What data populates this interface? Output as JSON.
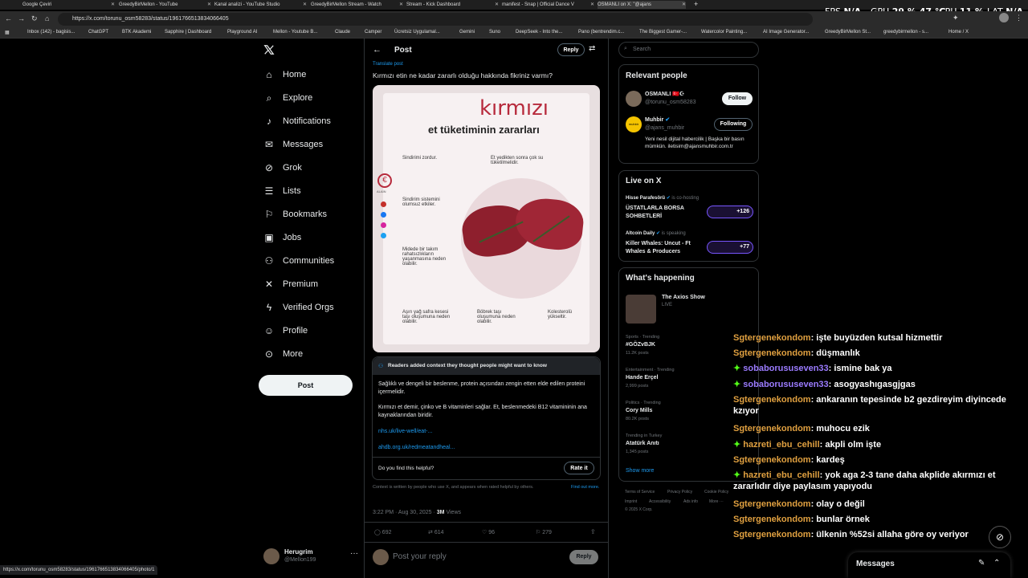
{
  "browser": {
    "tabs": [
      "Google Çeviri",
      "GreedyBirMellon - YouTube",
      "Kanal analizi - YouTube Studio",
      "GreedyBirMellon Stream - Watch",
      "Stream - Kick Dashboard",
      "manifest - Snap | Official Dance V",
      "OSMANLI on X: \"@ajans"
    ],
    "url": "https://x.com/torunu_osm58283/status/1961766513834066405",
    "bookmarks": [
      "Inbox (142) - bagisis...",
      "ChatGPT",
      "BTK Akademi",
      "Sapphire | Dashboard",
      "Playground AI",
      "Mellon - Youtube B...",
      "Claude",
      "Camper",
      "Ücretsiz Uygulamal...",
      "Gemini",
      "Suno",
      "DeepSeek - Into the...",
      "Pano (bentrendim.c...",
      "The Biggest Gamer-...",
      "Watercolor Painting...",
      "AI Image Generator...",
      "GreedyBirMellon St...",
      "greedybirmellon - s...",
      "Home / X"
    ],
    "status_url": "https://x.com/torunu_osm58283/status/1961766513834066405/photo/1"
  },
  "hud": {
    "fps_label": "FPS",
    "fps": "N/A",
    "gpu_label": "GPU",
    "gpu": "29 %  47 °C",
    "cpu_label": "CPU",
    "cpu": "11 %",
    "lat_label": "LAT",
    "lat": "N/A"
  },
  "nav": {
    "items": [
      "Home",
      "Explore",
      "Notifications",
      "Messages",
      "Grok",
      "Lists",
      "Bookmarks",
      "Jobs",
      "Communities",
      "Premium",
      "Verified Orgs",
      "Profile",
      "More"
    ],
    "post_button": "Post"
  },
  "account": {
    "name": "Herugrim",
    "handle": "@Mellon199"
  },
  "post": {
    "header": "Post",
    "reply_button": "Reply",
    "translate": "Translate post",
    "text": "Kırmızı etin ne kadar zararlı olduğu hakkında fikriniz varmı?",
    "image": {
      "title1": "kırmızı",
      "title2": "et tüketiminin zararları",
      "brand": "ALAİN",
      "facts": [
        "Sindirimi zordur.",
        "Et yedikten sonra çok su tüketilmelidir.",
        "Sindirim sistemini olumsuz etkiler.",
        "Midede bir takım rahatsızlıkların yaşanmasına neden olabilir.",
        "Aşırı yağ safra kesesi taşı oluşumuna neden olabilir.",
        "Böbrek taşı oluşumuna neden olabilir.",
        "Kolesterolü yükseltir."
      ]
    },
    "context": {
      "header": "Readers added context they thought people might want to know",
      "p1": "Sağlıklı ve dengeli bir beslenme, protein açısından zengin etten elde edilen proteini içermelidir.",
      "p2": "Kırmızı et demir, çinko ve B vitaminleri sağlar. Et, beslenmedeki B12 vitamininin ana kaynaklarından biridir.",
      "link1": "nhs.uk/live-well/eat-...",
      "link2": "ahdb.org.uk/redmeatandheal...",
      "helpful": "Do you find this helpful?",
      "rate": "Rate it",
      "footer": "Context is written by people who use X, and appears when rated helpful by others.",
      "find_out": "Find out more."
    },
    "meta": "3:22 PM · Aug 30, 2025 · ",
    "views": "3M",
    "views_label": " Views",
    "stats": {
      "replies": "692",
      "reposts": "614",
      "likes": "96",
      "bookmarks": "279"
    },
    "reply_placeholder": "Post your reply",
    "reply_btn": "Reply"
  },
  "right": {
    "search_placeholder": "Search",
    "relevant": {
      "title": "Relevant people",
      "p1": {
        "name": "OSMANLI 🇹🇷☪",
        "handle": "@torunu_osm58283",
        "btn": "Follow"
      },
      "p2": {
        "name": "Muhbir",
        "handle": "@ajans_muhbir",
        "btn": "Following",
        "bio": "Yeni nesil dijital habercilik | Başka bir basın mümkün. iletisim@ajansmuhbir.com.tr",
        "avatar_text": "muhbir"
      }
    },
    "live": {
      "title": "Live on X",
      "s1": {
        "host": "Hisse Parafesörü",
        "status": "is co-hosting",
        "title": "ÜSTATLARLA BORSA SOHBETLERİ",
        "count": "+126"
      },
      "s2": {
        "host": "Altcoin Daily",
        "status": "is speaking",
        "title": "Killer Whales: Uncut - Ft Whales & Producers",
        "count": "+77"
      }
    },
    "happening": {
      "title": "What's happening",
      "show": {
        "name": "The Axios Show",
        "status": "LIVE"
      },
      "trends": [
        {
          "cat": "Sports · Trending",
          "name": "#GÖZvBJK",
          "posts": "11.2K posts"
        },
        {
          "cat": "Entertainment · Trending",
          "name": "Hande Erçel",
          "posts": "2,999 posts"
        },
        {
          "cat": "Politics · Trending",
          "name": "Cory Mills",
          "posts": "80.2K posts"
        },
        {
          "cat": "Trending in Turkey",
          "name": "Atatürk Anıtı",
          "posts": "1,345 posts"
        }
      ],
      "show_more": "Show more"
    },
    "footer": [
      "Terms of Service",
      "Privacy Policy",
      "Cookie Policy",
      "Imprint",
      "Accessibility",
      "Ads info",
      "More ···",
      "© 2025 X Corp."
    ]
  },
  "chat": [
    {
      "user": "Sgtergenekondom",
      "msg": ": işte buyüzden kutsal hizmettir",
      "vip": false
    },
    {
      "user": "Sgtergenekondom",
      "msg": ": düşmanlık",
      "vip": false
    },
    {
      "user": "sobaborususeven33",
      "msg": ": ismine bak ya",
      "vip": true
    },
    {
      "user": "sobaborususeven33",
      "msg": ": asogyashıgasgjgas",
      "vip": true
    },
    {
      "user": "Sgtergenekondom",
      "msg": ": ankaranın tepesinde b2 gezdireyim diyincede",
      "cont": "kzıyor",
      "vip": false
    },
    {
      "user": "Sgtergenekondom",
      "msg": ": muhocu ezik",
      "vip": false
    },
    {
      "user": "hazreti_ebu_cehill",
      "msg": ": akpli olm işte",
      "vip": true
    },
    {
      "user": "Sgtergenekondom",
      "msg": ": kardeş",
      "vip": false
    },
    {
      "user": "hazreti_ebu_cehill",
      "msg": ": yok aga 2-3 tane daha akplide akırmızı et",
      "cont": "zararlıdır diye paylasım yapıyodu",
      "vip": true
    },
    {
      "user": "Sgtergenekondom",
      "msg": ": olay o değil",
      "vip": false
    },
    {
      "user": "Sgtergenekondom",
      "msg": ": bunlar örnek",
      "vip": false
    },
    {
      "user": "Sgtergenekondom",
      "msg": ": ülkenin %52si allaha göre oy veriyor",
      "vip": false
    }
  ],
  "messages_drawer": {
    "label": "Messages"
  }
}
